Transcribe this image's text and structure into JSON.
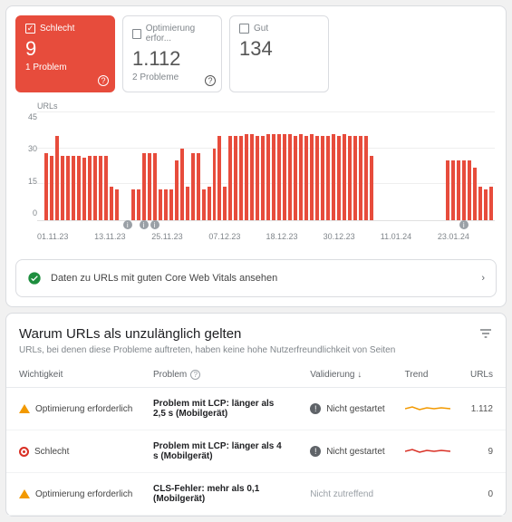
{
  "cards": {
    "bad": {
      "label": "Schlecht",
      "value": "9",
      "sub": "1 Problem"
    },
    "warn": {
      "label": "Optimierung erfor...",
      "value": "1.112",
      "sub": "2 Probleme"
    },
    "good": {
      "label": "Gut",
      "value": "134",
      "sub": ""
    }
  },
  "chart_data": {
    "type": "bar",
    "ylabel": "URLs",
    "ylim": [
      0,
      45
    ],
    "yticks": [
      45,
      30,
      15,
      0
    ],
    "xticks": [
      "01.11.23",
      "13.11.23",
      "25.11.23",
      "07.12.23",
      "18.12.23",
      "30.12.23",
      "11.01.24",
      "23.01.24"
    ],
    "values": [
      0,
      28,
      27,
      35,
      27,
      27,
      27,
      27,
      26,
      27,
      27,
      27,
      27,
      14,
      13,
      0,
      0,
      13,
      13,
      28,
      28,
      28,
      13,
      13,
      13,
      25,
      30,
      14,
      28,
      28,
      13,
      14,
      30,
      35,
      14,
      35,
      35,
      35,
      36,
      36,
      35,
      35,
      36,
      36,
      36,
      36,
      36,
      35,
      36,
      35,
      36,
      35,
      35,
      35,
      36,
      35,
      36,
      35,
      35,
      35,
      35,
      27,
      0,
      0,
      0,
      0,
      0,
      0,
      0,
      0,
      0,
      0,
      0,
      0,
      0,
      25,
      25,
      25,
      25,
      25,
      22,
      14,
      13,
      14
    ],
    "markers_at_index": [
      16,
      19,
      21,
      78
    ]
  },
  "banner_text": "Daten zu URLs mit guten Core Web Vitals ansehen",
  "table": {
    "title": "Warum URLs als unzulänglich gelten",
    "subtitle": "URLs, bei denen diese Probleme auftreten, haben keine hohe Nutzerfreundlichkeit von Seiten",
    "cols": {
      "c1": "Wichtigkeit",
      "c2": "Problem",
      "c3": "Validierung",
      "c4": "Trend",
      "c5": "URLs"
    },
    "rows": [
      {
        "sev": "warn",
        "sev_label": "Optimierung erforderlich",
        "problem": "Problem mit LCP: länger als 2,5 s (Mobilgerät)",
        "validation": "Nicht gestartet",
        "trend": "orange",
        "urls": "1.112"
      },
      {
        "sev": "bad",
        "sev_label": "Schlecht",
        "problem": "Problem mit LCP: länger als 4 s (Mobilgerät)",
        "validation": "Nicht gestartet",
        "trend": "red",
        "urls": "9"
      },
      {
        "sev": "warn",
        "sev_label": "Optimierung erforderlich",
        "problem": "CLS-Fehler: mehr als 0,1 (Mobilgerät)",
        "validation": "Nicht zutreffend",
        "validation_muted": true,
        "trend": "none",
        "urls": "0"
      }
    ]
  }
}
